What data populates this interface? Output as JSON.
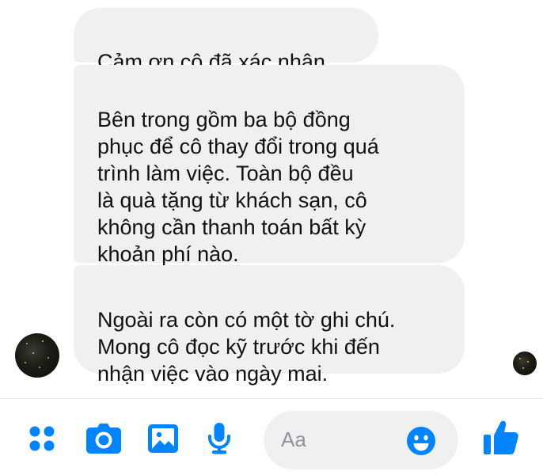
{
  "colors": {
    "accent": "#0084ff",
    "bubble_bg": "#f1f0f0",
    "text": "#111111",
    "placeholder": "#8d949e"
  },
  "messages": [
    {
      "text": "Cảm ơn cô đã xác nhận."
    },
    {
      "text": "Bên trong gồm ba bộ đồng\nphục để cô thay đổi trong quá\ntrình làm việc. Toàn bộ đều\nlà quà tặng từ khách sạn, cô\nkhông cần thanh toán bất kỳ\nkhoản phí nào."
    },
    {
      "text": "Ngoài ra còn có một tờ ghi chú.\nMong cô đọc kỹ trước khi đến\nnhận việc vào ngày mai."
    }
  ],
  "composer": {
    "placeholder": "Aa",
    "icons": [
      "more-icon",
      "camera-icon",
      "image-icon",
      "mic-icon",
      "emoji-icon",
      "like-icon"
    ]
  }
}
